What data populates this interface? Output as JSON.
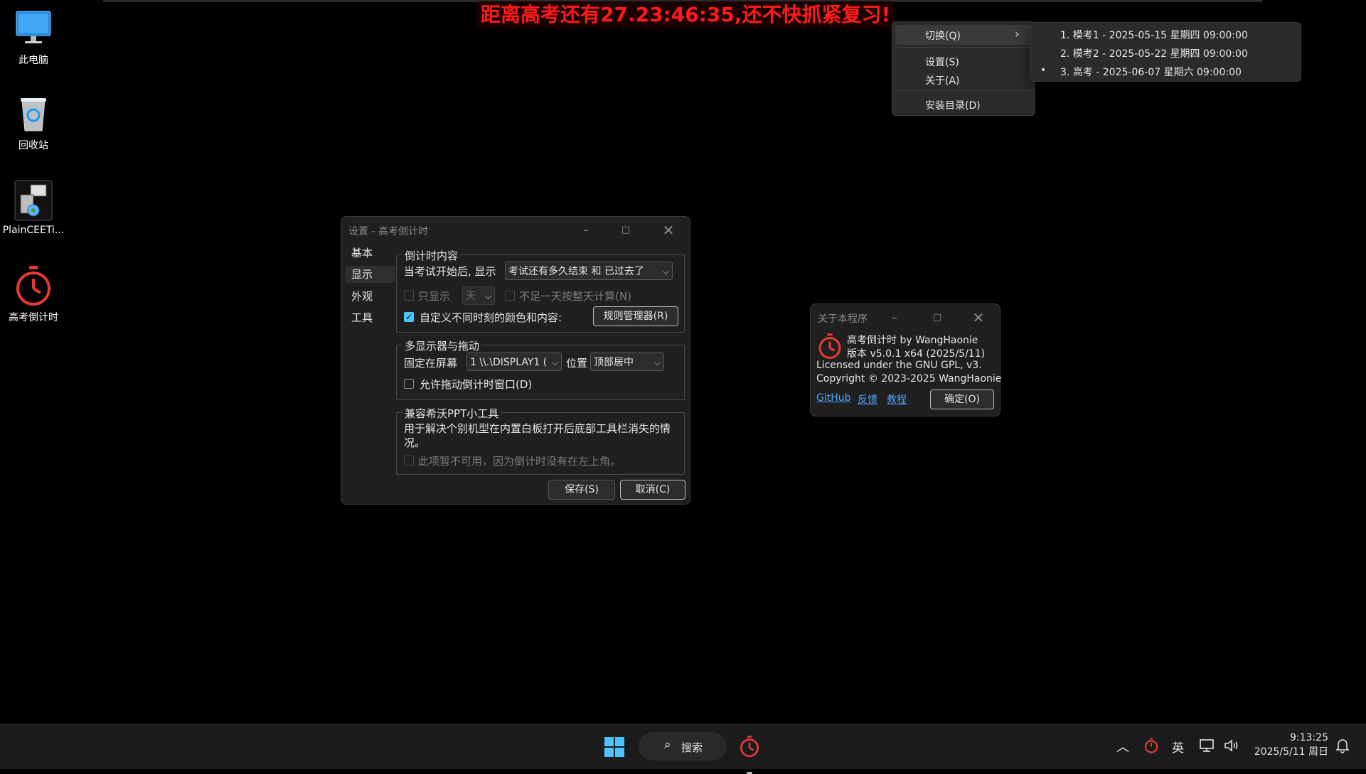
{
  "countdown": {
    "text": "距离高考还有27.23:46:35,还不快抓紧复习!"
  },
  "desktop": {
    "icons": [
      {
        "label": "此电脑"
      },
      {
        "label": "回收站"
      },
      {
        "label": "PlainCEETi..."
      },
      {
        "label": "高考倒计时"
      }
    ]
  },
  "context_menu": {
    "items": [
      "切换(Q)",
      "设置(S)",
      "关于(A)",
      "安装目录(D)"
    ],
    "submenu": [
      "1. 模考1 - 2025-05-15 星期四 09:00:00",
      "2. 模考2 - 2025-05-22 星期四 09:00:00",
      "3. 高考 - 2025-06-07 星期六 09:00:00"
    ],
    "submenu_selected_bullet": "•"
  },
  "settings": {
    "title": "设置 - 高考倒计时",
    "nav": [
      "基本",
      "显示",
      "外观",
      "工具"
    ],
    "group1": {
      "legend": "倒计时内容",
      "label_after_start": "当考试开始后, 显示",
      "combo_after_start": "考试还有多久结束 和 已过去了",
      "only_show_label": "只显示",
      "only_show_combo": "天",
      "less_than_day_label": "不足一天按整天计算(N)",
      "custom_label": "自定义不同时刻的颜色和内容:",
      "rules_button": "规则管理器(R)"
    },
    "group2": {
      "legend": "多显示器与拖动",
      "fixed_label": "固定在屏幕",
      "screen_combo": "1 \\\\.\\DISPLAY1 (",
      "position_label": "位置",
      "position_combo": "顶部居中",
      "drag_label": "允许拖动倒计时窗口(D)"
    },
    "group3": {
      "legend": "兼容希沃PPT小工具",
      "desc": "用于解决个别机型在内置白板打开后底部工具栏消失的情况。",
      "unavailable": "此项暂不可用，因为倒计时没有在左上角。"
    },
    "save_button": "保存(S)",
    "cancel_button": "取消(C)"
  },
  "about": {
    "title": "关于本程序",
    "line1": "高考倒计时 by WangHaonie",
    "line2": "版本 v5.0.1 x64 (2025/5/11)",
    "line3": "Licensed under the GNU GPL, v3.",
    "line4": "Copyright © 2023-2025 WangHaonie",
    "links": [
      "GitHub",
      "反馈",
      "教程"
    ],
    "ok_button": "确定(O)"
  },
  "taskbar": {
    "search_label": "搜索",
    "ime": "英",
    "time": "9:13:25",
    "date": "2025/5/11 周日"
  },
  "colors": {
    "accent": "#4cc2ff",
    "countdown": "#ff1a1a",
    "link": "#4da3ff"
  }
}
